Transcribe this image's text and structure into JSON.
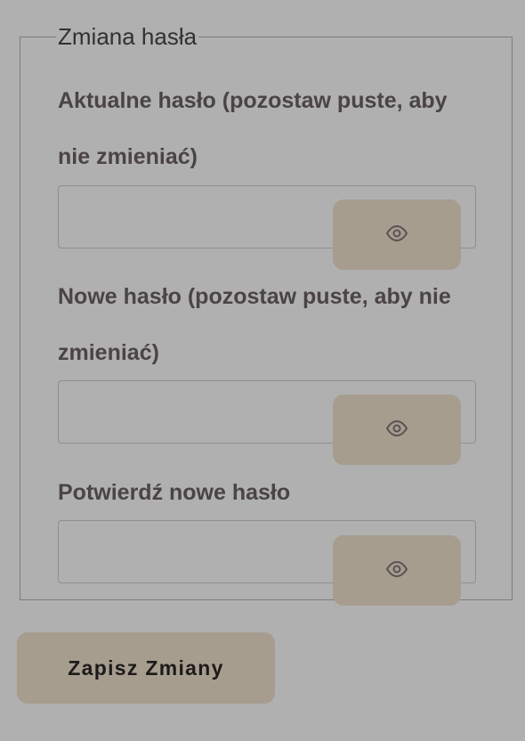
{
  "form": {
    "legend": "Zmiana hasła",
    "fields": [
      {
        "label": "Aktualne hasło (pozostaw puste, aby nie zmieniać)",
        "value": "",
        "toggle_icon": "eye-icon"
      },
      {
        "label": "Nowe hasło (pozostaw puste, aby nie zmieniać)",
        "value": "",
        "toggle_icon": "eye-icon"
      },
      {
        "label": "Potwierdź nowe hasło",
        "value": "",
        "toggle_icon": "eye-icon"
      }
    ],
    "submit_label": "Zapisz Zmiany"
  },
  "colors": {
    "background": "#b0b0b0",
    "button": "#a69d8f",
    "text": "#4a4444",
    "border": "#7c7c84"
  }
}
